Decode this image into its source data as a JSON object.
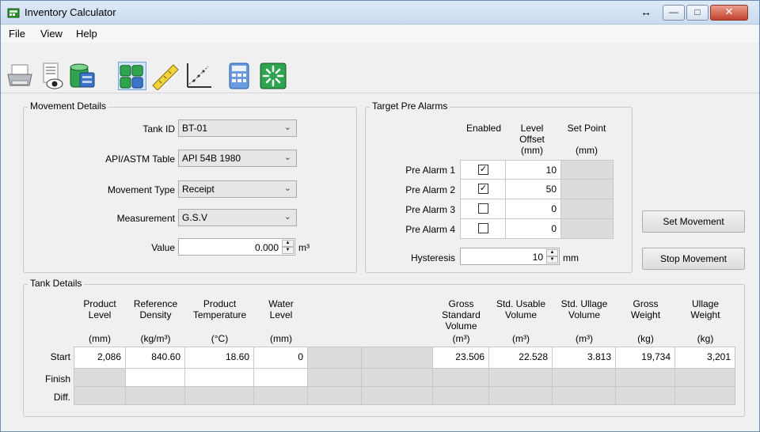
{
  "window": {
    "title": "Inventory Calculator",
    "resize_glyph": "↔"
  },
  "menu": [
    "File",
    "View",
    "Help"
  ],
  "toolbar": [
    "printer-icon",
    "view-report-icon",
    "tank-icon",
    "tanks-icon",
    "ruler-icon",
    "chart-icon",
    "calculator-icon",
    "refresh-icon"
  ],
  "movement": {
    "group_label": "Movement Details",
    "tank_id_label": "Tank ID",
    "tank_id": "BT-01",
    "api_label": "API/ASTM Table",
    "api": "API 54B 1980",
    "type_label": "Movement Type",
    "type": "Receipt",
    "measurement_label": "Measurement",
    "measurement": "G.S.V",
    "value_label": "Value",
    "value": "0.000",
    "value_unit": "m³"
  },
  "alarms": {
    "group_label": "Target Pre Alarms",
    "col_enabled": "Enabled",
    "col_offset": "Level Offset (mm)",
    "col_offset_lines": [
      "Level",
      "Offset",
      "(mm)"
    ],
    "col_setpoint_lines": [
      "Set Point",
      "(mm)"
    ],
    "rows": [
      {
        "label": "Pre Alarm 1",
        "enabled": true,
        "offset": "10"
      },
      {
        "label": "Pre Alarm 2",
        "enabled": true,
        "offset": "50"
      },
      {
        "label": "Pre Alarm 3",
        "enabled": false,
        "offset": "0"
      },
      {
        "label": "Pre Alarm 4",
        "enabled": false,
        "offset": "0"
      }
    ],
    "hysteresis_label": "Hysteresis",
    "hysteresis": "10",
    "hysteresis_unit": "mm",
    "check_glyph": "✓"
  },
  "buttons": {
    "set": "Set Movement",
    "stop": "Stop Movement"
  },
  "tank": {
    "group_label": "Tank Details",
    "headers": [
      {
        "lines": [
          "Product",
          "Level"
        ],
        "unit": "(mm)"
      },
      {
        "lines": [
          "Reference",
          "Density"
        ],
        "unit": "(kg/m³)"
      },
      {
        "lines": [
          "Product",
          "Temperature"
        ],
        "unit": "(°C)"
      },
      {
        "lines": [
          "Water",
          "Level"
        ],
        "unit": "(mm)"
      },
      {
        "lines": [
          ""
        ],
        "unit": ""
      },
      {
        "lines": [
          ""
        ],
        "unit": ""
      },
      {
        "lines": [
          "Gross",
          "Standard",
          "Volume"
        ],
        "unit": "(m³)"
      },
      {
        "lines": [
          "Std. Usable",
          "Volume"
        ],
        "unit": "(m³)"
      },
      {
        "lines": [
          "Std. Ullage",
          "Volume"
        ],
        "unit": "(m³)"
      },
      {
        "lines": [
          "Gross",
          "Weight"
        ],
        "unit": "(kg)"
      },
      {
        "lines": [
          "Ullage",
          "Weight"
        ],
        "unit": "(kg)"
      }
    ],
    "rows": [
      {
        "label": "Start",
        "values": [
          "2,086",
          "840.60",
          "18.60",
          "0",
          "",
          "",
          "23.506",
          "22.528",
          "3.813",
          "19,734",
          "3,201"
        ]
      },
      {
        "label": "Finish",
        "values": [
          "",
          "",
          "",
          "",
          "",
          "",
          "",
          "",
          "",
          "",
          ""
        ]
      },
      {
        "label": "Diff.",
        "values": [
          "",
          "",
          "",
          "",
          "",
          "",
          "",
          "",
          "",
          "",
          ""
        ]
      }
    ]
  }
}
